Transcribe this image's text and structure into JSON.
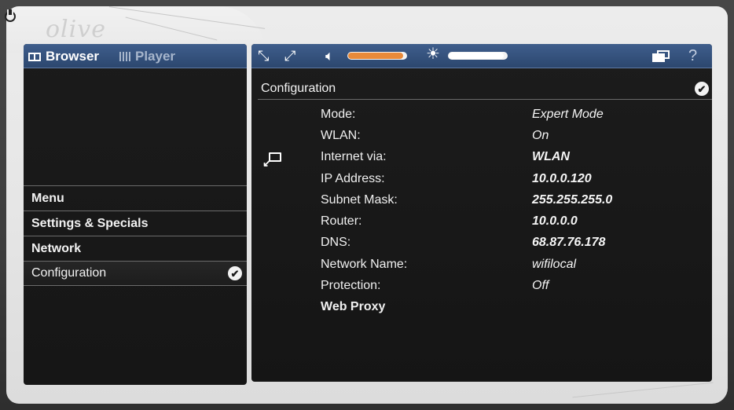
{
  "logo_text": "olive",
  "left_panel": {
    "tabs": [
      {
        "label": "Browser",
        "active": true
      },
      {
        "label": "Player",
        "active": false
      }
    ],
    "menu_items": [
      {
        "label": "Menu",
        "bold": true
      },
      {
        "label": "Settings & Specials",
        "bold": true
      },
      {
        "label": "Network",
        "bold": true
      },
      {
        "label": "Configuration",
        "bold": false,
        "selected": true
      }
    ]
  },
  "right_panel": {
    "header": {
      "volume_level": 0.95,
      "brightness_level": 0.95,
      "help_label": "?"
    },
    "title": "Configuration",
    "rows": [
      {
        "label": "Mode:",
        "value": "Expert Mode"
      },
      {
        "label": "WLAN:",
        "value": "On"
      },
      {
        "label": "Internet via:",
        "value": "WLAN"
      },
      {
        "label": "IP Address:",
        "value": "10.0.0.120"
      },
      {
        "label": "Subnet Mask:",
        "value": "255.255.255.0"
      },
      {
        "label": "Router:",
        "value": "10.0.0.0"
      },
      {
        "label": "DNS:",
        "value": "68.87.76.178"
      },
      {
        "label": "Network Name:",
        "value": "wifilocal"
      },
      {
        "label": "Protection:",
        "value": "Off"
      },
      {
        "label": "Web Proxy",
        "value": ""
      }
    ]
  },
  "colors": {
    "header_blue": "#34527e",
    "slider_orange": "#e88a3a",
    "panel_bg": "#1a1a1a"
  }
}
